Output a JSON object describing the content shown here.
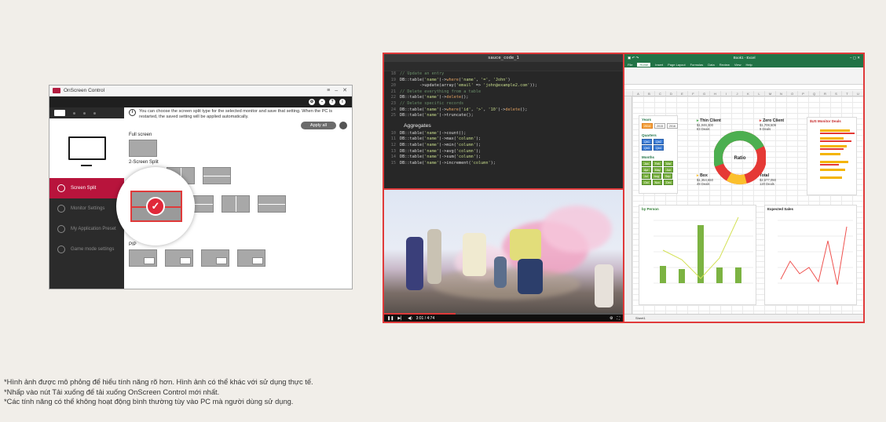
{
  "osc": {
    "title": "OnScreen Control",
    "info": "You can choose the screen split type for the selected monitor and save that setting. When the PC is restarted, the saved setting will be applied automatically.",
    "apply_label": "Apply all",
    "sections": {
      "full": "Full screen",
      "two": "2-Screen Split",
      "pip": "PIP"
    },
    "sidebar": [
      {
        "label": "Screen Split",
        "active": true
      },
      {
        "label": "Monitor Settings",
        "active": false
      },
      {
        "label": "My Application Preset",
        "active": false
      },
      {
        "label": "Game mode settings",
        "active": false
      }
    ]
  },
  "code": {
    "title": "sauce_code_1",
    "lines": [
      {
        "n": "18",
        "html": "<span class='cm'>// Update an entry</span>"
      },
      {
        "n": "19",
        "html": "DB::table(<span class='st'>'name'</span>)-><span class='kw'>where</span>(<span class='st'>'name'</span>, <span class='st'>'='</span>, <span class='st'>'John'</span>)"
      },
      {
        "n": "20",
        "html": "&nbsp;&nbsp;&nbsp;&nbsp;&nbsp;&nbsp;&nbsp;&nbsp;->update(array(<span class='st'>'email'</span> => <span class='st'>'john@example2.com'</span>));"
      },
      {
        "n": "21",
        "html": "<span class='cm'>// Delete everything from a table</span>"
      },
      {
        "n": "22",
        "html": "DB::table(<span class='st'>'name'</span>)-><span class='kw'>delete</span>();"
      },
      {
        "n": "23",
        "html": "<span class='cm'>// Delete specific records</span>"
      },
      {
        "n": "24",
        "html": "DB::table(<span class='st'>'name'</span>)-><span class='kw'>where</span>(<span class='st'>'id'</span>, <span class='st'>'>'</span>, <span class='st'>'10'</span>)-><span class='kw'>delete</span>();"
      },
      {
        "n": "25",
        "html": "DB::table(<span class='st'>'name'</span>)->truncate();"
      }
    ],
    "heading": "Aggregates",
    "agg_lines": [
      {
        "n": "10",
        "html": "DB::table(<span class='st'>'name'</span>)->count();"
      },
      {
        "n": "11",
        "html": "DB::table(<span class='st'>'name'</span>)->max(<span class='st'>'column'</span>);"
      },
      {
        "n": "12",
        "html": "DB::table(<span class='st'>'name'</span>)->min(<span class='st'>'column'</span>);"
      },
      {
        "n": "13",
        "html": "DB::table(<span class='st'>'name'</span>)->avg(<span class='st'>'column'</span>);"
      },
      {
        "n": "14",
        "html": "DB::table(<span class='st'>'name'</span>)->sum(<span class='st'>'column'</span>);"
      },
      {
        "n": "15",
        "html": "DB::table(<span class='st'>'name'</span>)->increment(<span class='st'>'column'</span>);"
      }
    ]
  },
  "video": {
    "time": "3:01 / 4:74"
  },
  "excel": {
    "title": "Book1 - Excel",
    "tabs": [
      "File",
      "Home",
      "Insert",
      "Page Layout",
      "Formulas",
      "Data",
      "Review",
      "View",
      "Help"
    ],
    "slicers": {
      "years": "Years",
      "quarters": "Quarters",
      "months": "Months"
    },
    "kpis": {
      "thin": {
        "label": "Thin Client",
        "v1": "$1,046,300",
        "v2": "63 Deals"
      },
      "zero": {
        "label": "Zero Client",
        "v1": "$1,708,509",
        "v2": "9 Deals"
      },
      "box": {
        "label": "Box",
        "v1": "$1,354,650",
        "v2": "48 Deals"
      },
      "total": {
        "label": "Total",
        "v1": "$2,577,050",
        "v2": "120 Deals"
      },
      "ratio": "Ratio"
    },
    "deals_title": "$US Monitor Deals",
    "person_title": "by Person",
    "expected_title": "Expected Sales",
    "sheet": "Sheet1"
  },
  "notes": [
    "*Hình ảnh được mô phỏng để hiểu tính năng rõ hơn. Hình ảnh có thể khác với sử dụng thực tế.",
    "*Nhấp vào nút Tải xuống để tải xuống OnScreen Control mới nhất.",
    "*Các tính năng có thể không hoạt động bình thường tùy vào PC mà người dùng sử dụng."
  ]
}
